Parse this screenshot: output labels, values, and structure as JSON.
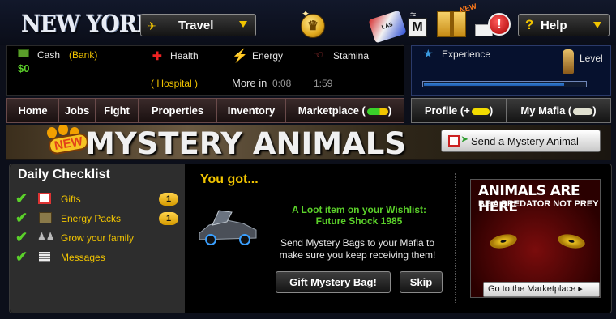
{
  "header": {
    "city": "NEW YORK",
    "travel_label": "Travel",
    "help_label": "Help",
    "help_icon": "?",
    "alert_icon": "!",
    "mafia_badge": "M",
    "new_tag": "NEW",
    "vegas_sign": "LAS VEGAS"
  },
  "stats": {
    "cash_label": "Cash",
    "bank_label": "(Bank)",
    "cash_value": "$0",
    "health_label": "Health",
    "hospital_label": "( Hospital )",
    "energy_label": "Energy",
    "stamina_label": "Stamina",
    "more_in_label": "More in",
    "energy_timer": "0:08",
    "stamina_timer": "1:59",
    "experience_label": "Experience",
    "level_label": "Level",
    "experience_progress": 0.87
  },
  "nav": {
    "items": [
      "Home",
      "Jobs",
      "Fight",
      "Properties",
      "Inventory",
      "Marketplace ("
    ],
    "profile": "Profile (+",
    "my_mafia": "My Mafia ("
  },
  "banner": {
    "new_badge": "NEW",
    "title": "MYSTERY ANIMALS",
    "send_button": "Send a Mystery Animal"
  },
  "checklist": {
    "title": "Daily Checklist",
    "items": [
      {
        "label": "Gifts",
        "count": "1",
        "icon": "gift-icon"
      },
      {
        "label": "Energy Packs",
        "count": "1",
        "icon": "energy-pack-icon"
      },
      {
        "label": "Grow your family",
        "count": "",
        "icon": "family-icon"
      },
      {
        "label": "Messages",
        "count": "",
        "icon": "message-icon"
      }
    ]
  },
  "reward": {
    "heading": "You got...",
    "loot_line1": "A Loot item on your Wishlist:",
    "loot_line2": "Future Shock 1985",
    "send_line1": "Send Mystery Bags to your Mafia to",
    "send_line2": "make sure you keep receiving them!",
    "gift_button": "Gift Mystery Bag!",
    "skip_button": "Skip"
  },
  "ad": {
    "title": "ANIMALS ARE HERE",
    "subtitle": "BE A PREDATOR NOT PREY",
    "button": "Go to the Marketplace ▸"
  },
  "colors": {
    "gold": "#f2c500",
    "green": "#5bd12a",
    "nav_border": "#6a4a4a"
  }
}
